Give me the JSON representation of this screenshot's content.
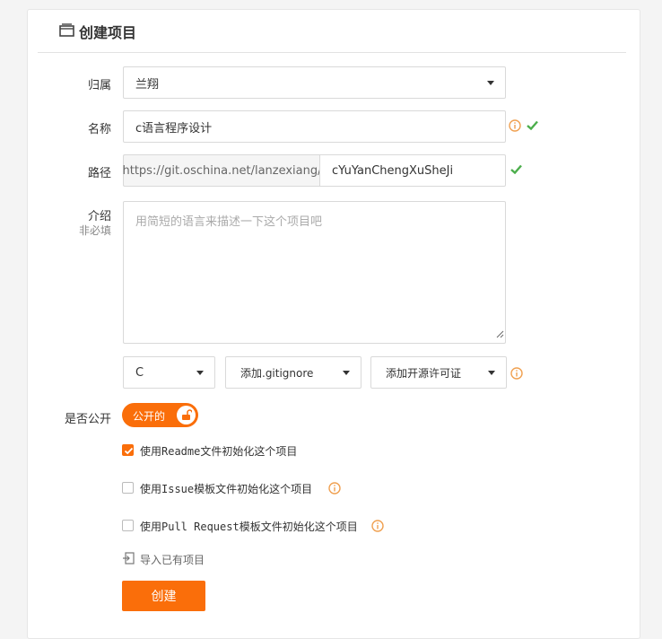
{
  "page": {
    "title": "创建项目"
  },
  "form": {
    "owner": {
      "label": "归属",
      "value": "兰翔"
    },
    "name": {
      "label": "名称",
      "value": "c语言程序设计"
    },
    "path": {
      "label": "路径",
      "prefix": "https://git.oschina.net/lanzexiang/",
      "value": "cYuYanChengXuSheJi"
    },
    "description": {
      "label": "介绍",
      "sublabel": "非必填",
      "placeholder": "用简短的语言来描述一下这个项目吧"
    },
    "language": {
      "value": "C"
    },
    "gitignore": {
      "value": "添加.gitignore"
    },
    "license": {
      "value": "添加开源许可证"
    },
    "visibility": {
      "label": "是否公开",
      "toggle_text": "公开的"
    },
    "options": [
      {
        "label": "使用Readme文件初始化这个项目",
        "checked": true
      },
      {
        "label": "使用Issue模板文件初始化这个项目",
        "checked": false
      },
      {
        "label": "使用Pull Request模板文件初始化这个项目",
        "checked": false
      }
    ],
    "import_link": "导入已有项目",
    "submit_label": "创建"
  },
  "colors": {
    "accent": "#fa6e0a",
    "success": "#4cae4c",
    "info": "#f0a050"
  }
}
